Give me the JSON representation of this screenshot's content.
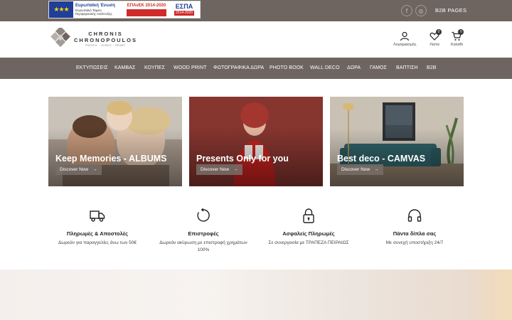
{
  "topbar": {
    "eu_banner": {
      "flag_stars": "★★★",
      "eu_title": "Ευρωπαϊκή Ένωση",
      "eu_sub1": "Ευρωπαϊκό Ταμείο",
      "eu_sub2": "Περιφερειακής Ανάπτυξης",
      "epanek": "ΕΠΑνΕΚ 2014-2020",
      "espa": "ΕΣΠΑ",
      "espa_years": "2014-2020"
    },
    "social": [
      {
        "name": "facebook-icon",
        "glyph": "f"
      },
      {
        "name": "instagram-icon",
        "glyph": "◎"
      }
    ],
    "b2b_pages": "B2B PAGES"
  },
  "header": {
    "logo": {
      "line1": "CHRONIS",
      "line2": "CHRONOPOULOS",
      "tagline": "PHOTO · VIDEO · PRINT"
    },
    "icons": {
      "account_label": "Λογαριασμός",
      "wishlist_label": "Λίστα",
      "wishlist_count": "0",
      "cart_label": "Καλάθι",
      "cart_count": "0"
    }
  },
  "nav": {
    "items": [
      "ΕΚΤΥΠΩΣΕΙΣ",
      "ΚΑΜΒΑΣ",
      "ΚΟΥΠΕΣ",
      "WOOD PRINT",
      "ΦΩΤΟΓΡΑΦΙΚΑ ΔΩΡΑ",
      "PHOTO BOOK",
      "WALL DECO",
      "ΔΩΡΑ",
      "ΓΑΜΟΣ",
      "ΒΑΠΤΙΣΗ",
      "B2B"
    ]
  },
  "banners": [
    {
      "title": "Keep Memories - ALBUMS",
      "button": "Discover Now",
      "arrow": "→"
    },
    {
      "title": "Presents Only for you",
      "button": "Discover Now",
      "arrow": "→"
    },
    {
      "title": "Best deco - CAMVAS",
      "button": "Discover Now",
      "arrow": "→"
    }
  ],
  "features": [
    {
      "icon": "truck-icon",
      "title": "Πληρωμές & Αποστολές",
      "desc": "Δωρεάν για παραγγελίες άνω των 50€"
    },
    {
      "icon": "refresh-icon",
      "title": "Επιστροφές",
      "desc": "Δωρεάν ακύρωση με επιστροφή χρημάτων 100%"
    },
    {
      "icon": "lock-icon",
      "title": "Ασφαλείς Πληρωμές",
      "desc": "Σε συνεργασία με ΤΡΑΠΕΖΑ ΠΕΙΡΑΙΩΣ"
    },
    {
      "icon": "headphones-icon",
      "title": "Πάντα δίπλα σας",
      "desc": "Με συνεχή υποστήριξη 24/7"
    }
  ],
  "colors": {
    "brand_bar": "#6e6560",
    "eu_blue": "#1f3f99",
    "espa_red": "#d12a2a"
  }
}
